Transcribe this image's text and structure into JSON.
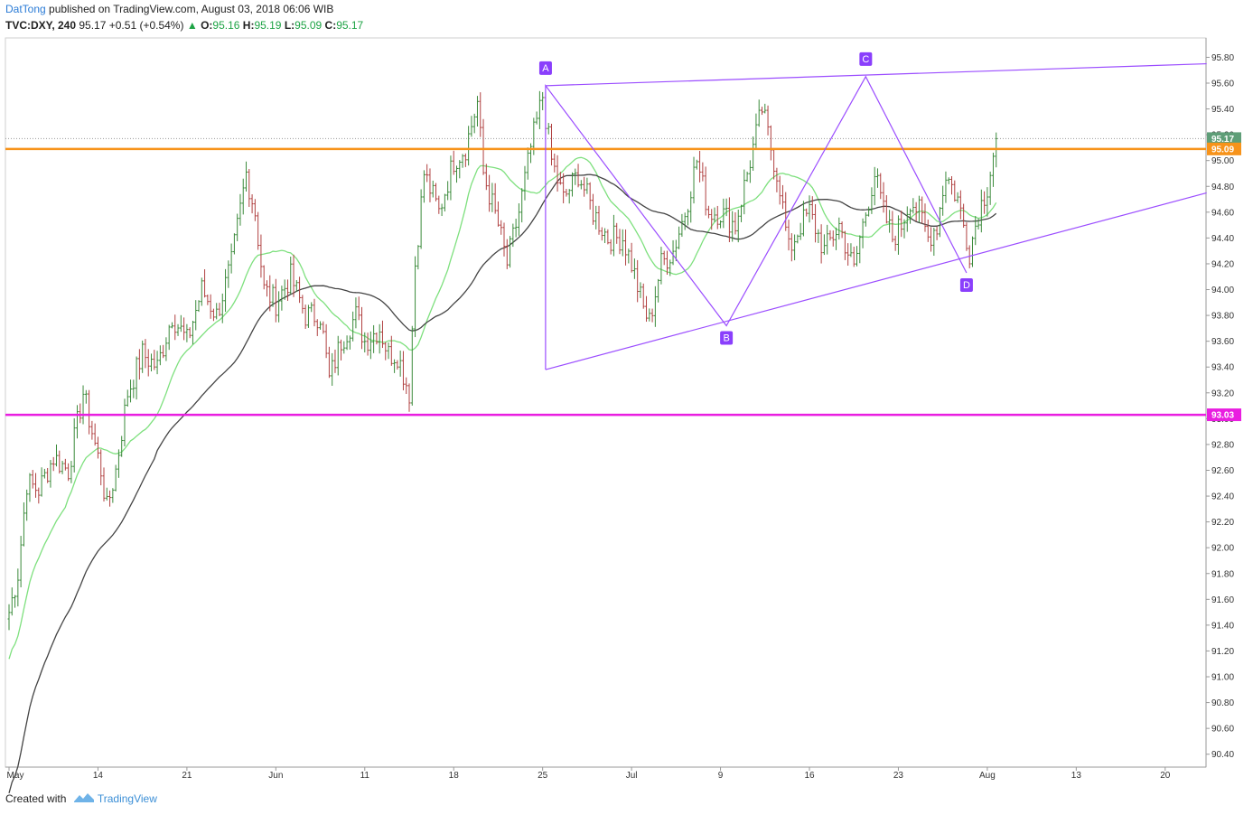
{
  "header": {
    "author": "DatTong",
    "published_text": " published on TradingView.com, August 03, 2018 06:06 WIB",
    "symbol": "TVC:DXY, 240",
    "last": "95.17",
    "change": "+0.51 (+0.54%)",
    "change_arrow": "▲",
    "o_label": "O:",
    "o_value": "95.16",
    "h_label": "H:",
    "h_value": "95.19",
    "l_label": "L:",
    "l_value": "95.09",
    "c_label": "C:",
    "c_value": "95.17"
  },
  "footer": {
    "created_with": "Created with",
    "brand": "TradingView"
  },
  "colors": {
    "orange_level": "#f7931a",
    "magenta_level": "#e91ee0",
    "pattern": "#9b4dff",
    "point_label": "#8a3ffc",
    "ma_fast": "#7ee07e",
    "ma_slow": "#444444",
    "bar_up": "#3a8a3a",
    "bar_down": "#b04040",
    "last_price_tag": "#5f9e78"
  },
  "chart_data": {
    "type": "ohlc",
    "ylim": [
      90.3,
      95.95
    ],
    "y_ticks": [
      "95.80",
      "95.60",
      "95.40",
      "95.20",
      "95.00",
      "94.80",
      "94.60",
      "94.40",
      "94.20",
      "94.00",
      "93.80",
      "93.60",
      "93.40",
      "93.20",
      "93.00",
      "92.80",
      "92.60",
      "92.40",
      "92.20",
      "92.00",
      "91.80",
      "91.60",
      "91.40",
      "91.20",
      "91.00",
      "90.80",
      "90.60",
      "90.40"
    ],
    "x_ticks": [
      {
        "label": "May",
        "bar": 0
      },
      {
        "label": "14",
        "bar": 30
      },
      {
        "label": "21",
        "bar": 60
      },
      {
        "label": "Jun",
        "bar": 90
      },
      {
        "label": "11",
        "bar": 120
      },
      {
        "label": "18",
        "bar": 150
      },
      {
        "label": "25",
        "bar": 180
      },
      {
        "label": "Jul",
        "bar": 210
      },
      {
        "label": "9",
        "bar": 240
      },
      {
        "label": "16",
        "bar": 270
      },
      {
        "label": "23",
        "bar": 300
      },
      {
        "label": "Aug",
        "bar": 330
      },
      {
        "label": "13",
        "bar": 360
      },
      {
        "label": "20",
        "bar": 390
      }
    ],
    "total_bars": 405,
    "last_bar": 333,
    "horizontal_levels": [
      {
        "value": 95.09,
        "label": "95.09",
        "color": "#f7931a"
      },
      {
        "value": 93.03,
        "label": "93.03",
        "color": "#e91ee0"
      }
    ],
    "last_price": {
      "value": 95.17,
      "label": "95.17"
    },
    "anchors": [
      [
        0,
        91.5
      ],
      [
        3,
        91.8
      ],
      [
        6,
        92.5
      ],
      [
        10,
        92.45
      ],
      [
        15,
        92.7
      ],
      [
        20,
        92.6
      ],
      [
        25,
        93.2
      ],
      [
        28,
        92.9
      ],
      [
        31,
        92.6
      ],
      [
        33,
        92.3
      ],
      [
        36,
        92.6
      ],
      [
        40,
        93.2
      ],
      [
        45,
        93.5
      ],
      [
        50,
        93.4
      ],
      [
        55,
        93.8
      ],
      [
        60,
        93.6
      ],
      [
        65,
        94.0
      ],
      [
        70,
        93.8
      ],
      [
        75,
        94.2
      ],
      [
        80,
        94.9
      ],
      [
        83,
        94.6
      ],
      [
        86,
        94.0
      ],
      [
        90,
        93.9
      ],
      [
        95,
        94.1
      ],
      [
        100,
        93.8
      ],
      [
        105,
        93.8
      ],
      [
        108,
        93.3
      ],
      [
        112,
        93.6
      ],
      [
        117,
        93.8
      ],
      [
        120,
        93.6
      ],
      [
        125,
        93.7
      ],
      [
        128,
        93.5
      ],
      [
        131,
        93.5
      ],
      [
        135,
        93.2
      ],
      [
        137,
        94.2
      ],
      [
        140,
        94.9
      ],
      [
        145,
        94.6
      ],
      [
        150,
        95.0
      ],
      [
        154,
        95.1
      ],
      [
        158,
        95.45
      ],
      [
        160,
        94.9
      ],
      [
        165,
        94.5
      ],
      [
        168,
        94.2
      ],
      [
        172,
        94.6
      ],
      [
        176,
        95.1
      ],
      [
        180,
        95.5
      ],
      [
        183,
        95.0
      ],
      [
        187,
        94.7
      ],
      [
        192,
        94.9
      ],
      [
        197,
        94.6
      ],
      [
        202,
        94.4
      ],
      [
        207,
        94.4
      ],
      [
        210,
        94.2
      ],
      [
        214,
        93.85
      ],
      [
        216,
        93.75
      ],
      [
        220,
        94.2
      ],
      [
        224,
        94.3
      ],
      [
        228,
        94.6
      ],
      [
        232,
        95.0
      ],
      [
        236,
        94.6
      ],
      [
        240,
        94.6
      ],
      [
        245,
        94.5
      ],
      [
        250,
        95.0
      ],
      [
        254,
        95.4
      ],
      [
        257,
        95.1
      ],
      [
        260,
        94.8
      ],
      [
        263,
        94.3
      ],
      [
        267,
        94.5
      ],
      [
        270,
        94.6
      ],
      [
        275,
        94.3
      ],
      [
        280,
        94.5
      ],
      [
        285,
        94.15
      ],
      [
        287,
        94.4
      ],
      [
        290,
        94.7
      ],
      [
        292,
        94.9
      ],
      [
        295,
        94.6
      ],
      [
        298,
        94.4
      ],
      [
        301,
        94.5
      ],
      [
        304,
        94.7
      ],
      [
        307,
        94.6
      ],
      [
        310,
        94.4
      ],
      [
        313,
        94.5
      ],
      [
        316,
        94.9
      ],
      [
        320,
        94.7
      ],
      [
        324,
        94.3
      ],
      [
        327,
        94.6
      ],
      [
        330,
        94.8
      ],
      [
        333,
        95.17
      ]
    ],
    "moving_averages": [
      {
        "name": "fast",
        "period": 20,
        "color": "#7ee07e"
      },
      {
        "name": "slow",
        "period": 50,
        "color": "#444444"
      }
    ],
    "pattern_points": [
      {
        "label": "A",
        "bar": 181,
        "price": 95.58
      },
      {
        "label": "B",
        "bar": 242,
        "price": 93.72
      },
      {
        "label": "C",
        "bar": 289,
        "price": 95.65
      },
      {
        "label": "D",
        "bar": 323,
        "price": 94.13
      }
    ],
    "pattern_extra": {
      "bar": 181,
      "price": 93.38
    },
    "trendlines": [
      {
        "from": {
          "bar": 181,
          "price": 95.58
        },
        "to": {
          "bar": 404,
          "price": 95.75
        }
      },
      {
        "from": {
          "bar": 181,
          "price": 93.38
        },
        "to": {
          "bar": 404,
          "price": 94.75
        }
      }
    ]
  }
}
